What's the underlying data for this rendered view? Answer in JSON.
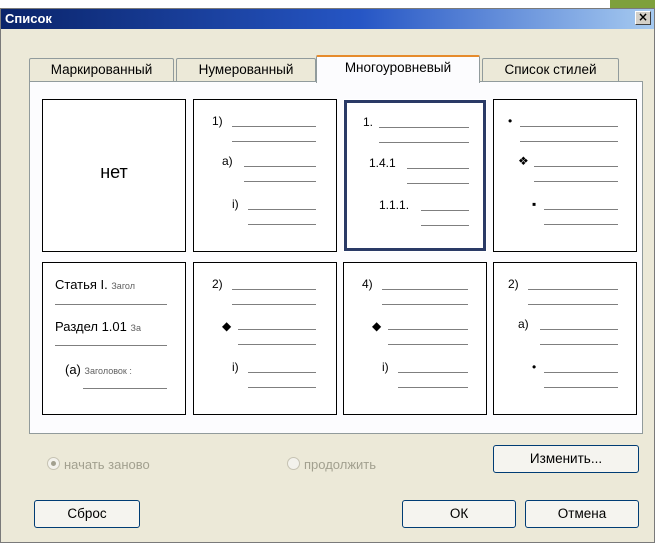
{
  "dialog": {
    "title": "Список",
    "close_label": "×"
  },
  "tabs": [
    {
      "label": "Маркированный",
      "active": false
    },
    {
      "label": "Нумерованный",
      "active": false
    },
    {
      "label": "Многоуровневый",
      "active": true
    },
    {
      "label": "Список стилей",
      "active": false
    }
  ],
  "gallery": {
    "none_label": "нет",
    "c2": {
      "l1": "1)",
      "l2": "a)",
      "l3": "i)"
    },
    "c3": {
      "l1": "1.",
      "l2": "1.4.1",
      "l3": "1.1.1."
    },
    "c4": {
      "l1": "•",
      "l2": "❖",
      "l3": "▪"
    },
    "c5": {
      "l1_main": "Статья I.",
      "l1_sub": "Загол",
      "l2_main": "Раздел 1.01",
      "l2_sub": "За",
      "l3_main": "(а)",
      "l3_sub": "Заголовок :"
    },
    "c6": {
      "l1": "2)",
      "l2": "◆",
      "l3": "i)"
    },
    "c7": {
      "l1": "4)",
      "l2": "◆",
      "l3": "i)"
    },
    "c8": {
      "l1": "2)",
      "l2": "a)",
      "l3": "•"
    }
  },
  "numbering": {
    "restart_label": "начать заново",
    "continue_label": "продолжить",
    "selected": "restart"
  },
  "buttons": {
    "change": "Изменить...",
    "reset": "Сброс",
    "ok": "ОК",
    "cancel": "Отмена"
  },
  "colors": {
    "titlebar": "#0a246a",
    "tab_highlight": "#e68b2c",
    "dialog_bg": "#ece9d8",
    "button_border": "#003c74"
  }
}
